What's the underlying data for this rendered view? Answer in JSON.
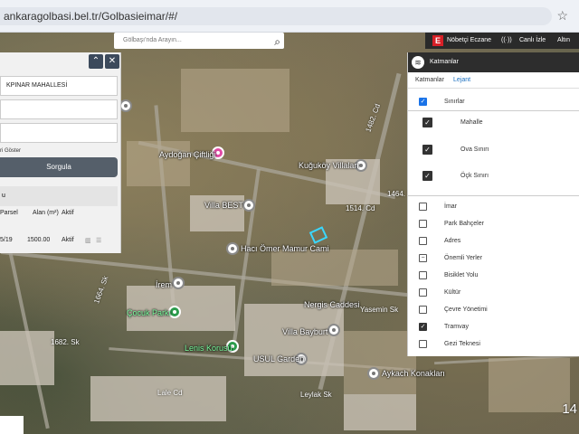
{
  "browser": {
    "url": "ankaragolbasi.bel.tr/Golbasieimar/#/",
    "star_icon": "star-icon"
  },
  "search": {
    "placeholder": "Gölbaşı'nda Arayın..."
  },
  "topbar": {
    "nobetci": "Nöbetçi Eczane",
    "canli": "Canlı İzle",
    "altin": "Altın"
  },
  "left_panel": {
    "mahalle_value": "KPINAR MAHALLESİ",
    "show_label": "ri Göster",
    "query_button": "Sorgula",
    "result_header": "u",
    "columns": [
      "Parsel",
      "Alan (m²)",
      "Aktif"
    ],
    "row": {
      "parsel": "5/19",
      "alan": "1500.00",
      "aktif": "Aktif"
    }
  },
  "layers_panel": {
    "title": "Katmanlar",
    "tabs": [
      "Katmanlar",
      "Lejant"
    ],
    "groups": [
      {
        "label": "Sınırlar",
        "checked": true
      },
      {
        "label": "Mahalle",
        "checked": true
      },
      {
        "label": "Ova Sınırı",
        "checked": true
      },
      {
        "label": "Öçk Sınırı",
        "checked": true
      },
      {
        "label": "İmar",
        "checked": false
      },
      {
        "label": "Park Bahçeler",
        "checked": false
      },
      {
        "label": "Adres",
        "checked": false
      },
      {
        "label": "Önemli Yerler",
        "checked": "partial"
      },
      {
        "label": "Bisiklet Yolu",
        "checked": false
      },
      {
        "label": "Kültür",
        "checked": false
      },
      {
        "label": "Çevre Yönetimi",
        "checked": false
      },
      {
        "label": "Tramvay",
        "checked": true
      },
      {
        "label": "Gezi Teknesi",
        "checked": false
      }
    ]
  },
  "map_labels": {
    "aydogan": "Aydoğan Çiftliği",
    "kuguk": "Kuğuköy Villaları",
    "villa_best": "Villa BEST",
    "haci": "Hacı Ömer Mamur Cami",
    "irem": "İrem",
    "cocuk": "Çocuk Parkı",
    "lenis": "Lenis Korusu",
    "nergis": "Nergis Caddesi",
    "villa_bay": "Villa Bayburt",
    "usul": "USUL Garden",
    "aykach": "Aykach Konakları",
    "yasemin": "Yasemin Sk",
    "cd_1482": "1482. Cd",
    "cd_1514": "1514. Cd",
    "cd_1464": "1464. Sk",
    "sk_1682": "1682. Sk",
    "sk_1664": "1664. Sk",
    "lale": "Lale Cd",
    "leylak": "Leylak Sk",
    "zoom": "14"
  }
}
